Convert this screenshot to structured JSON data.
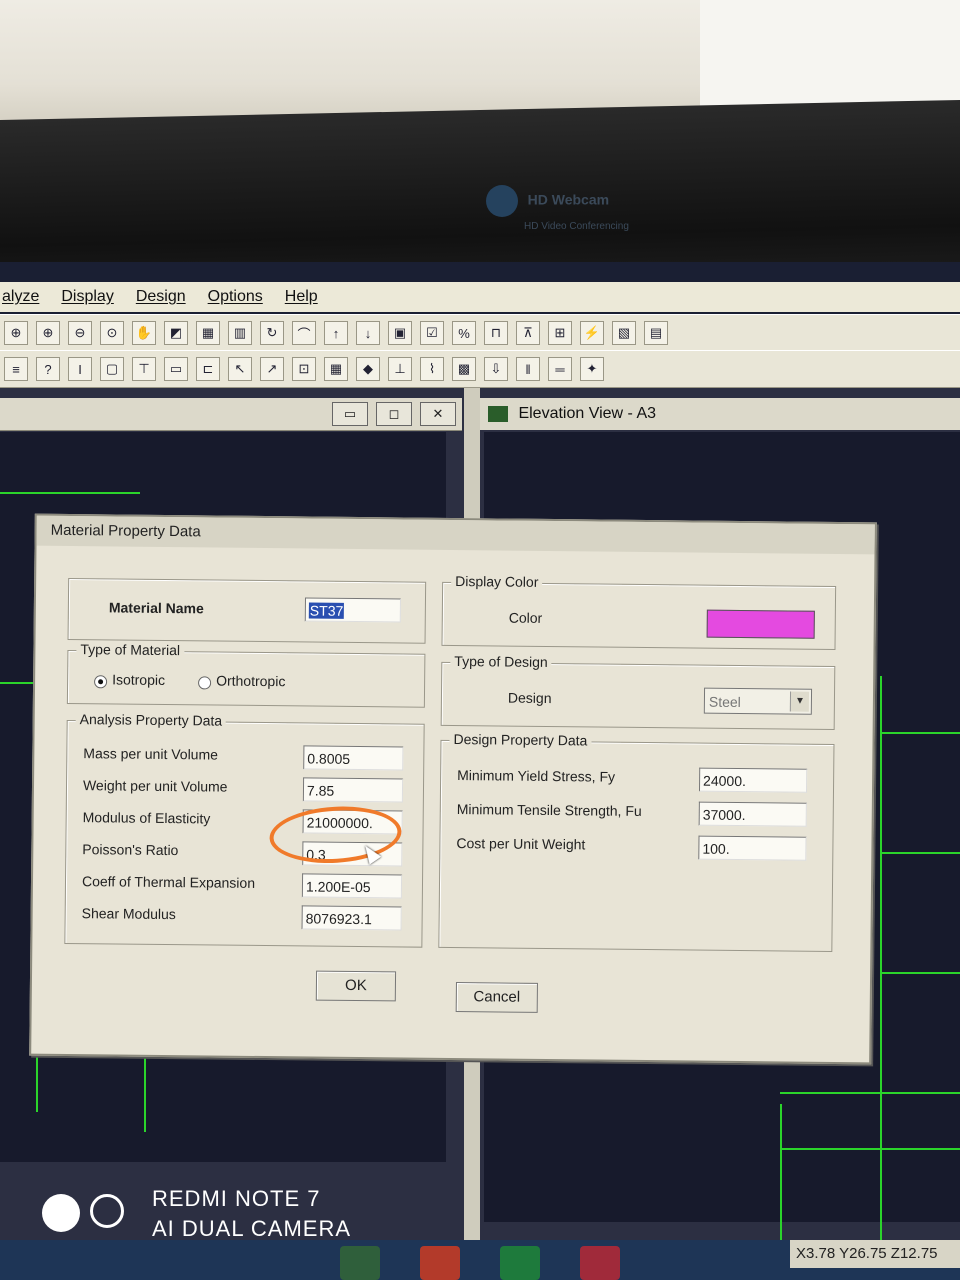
{
  "webcam": {
    "name": "HD Webcam",
    "sub": "HD Video Conferencing"
  },
  "menu": [
    "alyze",
    "Display",
    "Design",
    "Options",
    "Help"
  ],
  "window_right_title": "Elevation View - A3",
  "dialog": {
    "title": "Material Property Data",
    "material_name_label": "Material Name",
    "material_name_value": "ST37",
    "type_of_material": {
      "legend": "Type of Material",
      "isotropic": "Isotropic",
      "orthotropic": "Orthotropic",
      "selected": "Isotropic"
    },
    "analysis": {
      "legend": "Analysis Property Data",
      "rows": [
        {
          "label": "Mass per unit Volume",
          "value": "0.8005"
        },
        {
          "label": "Weight per unit Volume",
          "value": "7.85"
        },
        {
          "label": "Modulus of Elasticity",
          "value": "21000000."
        },
        {
          "label": "Poisson's Ratio",
          "value": "0.3"
        },
        {
          "label": "Coeff of Thermal Expansion",
          "value": "1.200E-05"
        },
        {
          "label": "Shear Modulus",
          "value": "8076923.1"
        }
      ]
    },
    "display_color": {
      "legend": "Display Color",
      "label": "Color",
      "color": "#e44ae0"
    },
    "type_of_design": {
      "legend": "Type of Design",
      "label": "Design",
      "value": "Steel"
    },
    "design_property": {
      "legend": "Design Property Data",
      "rows": [
        {
          "label": "Minimum Yield Stress, Fy",
          "value": "24000."
        },
        {
          "label": "Minimum Tensile Strength, Fu",
          "value": "37000."
        },
        {
          "label": "Cost per Unit Weight",
          "value": "100."
        }
      ]
    },
    "ok_label": "OK",
    "cancel_label": "Cancel"
  },
  "status_coords": "X3.78  Y26.75  Z12.75",
  "watermark": {
    "line1": "REDMI NOTE 7",
    "line2": "AI DUAL CAMERA"
  }
}
